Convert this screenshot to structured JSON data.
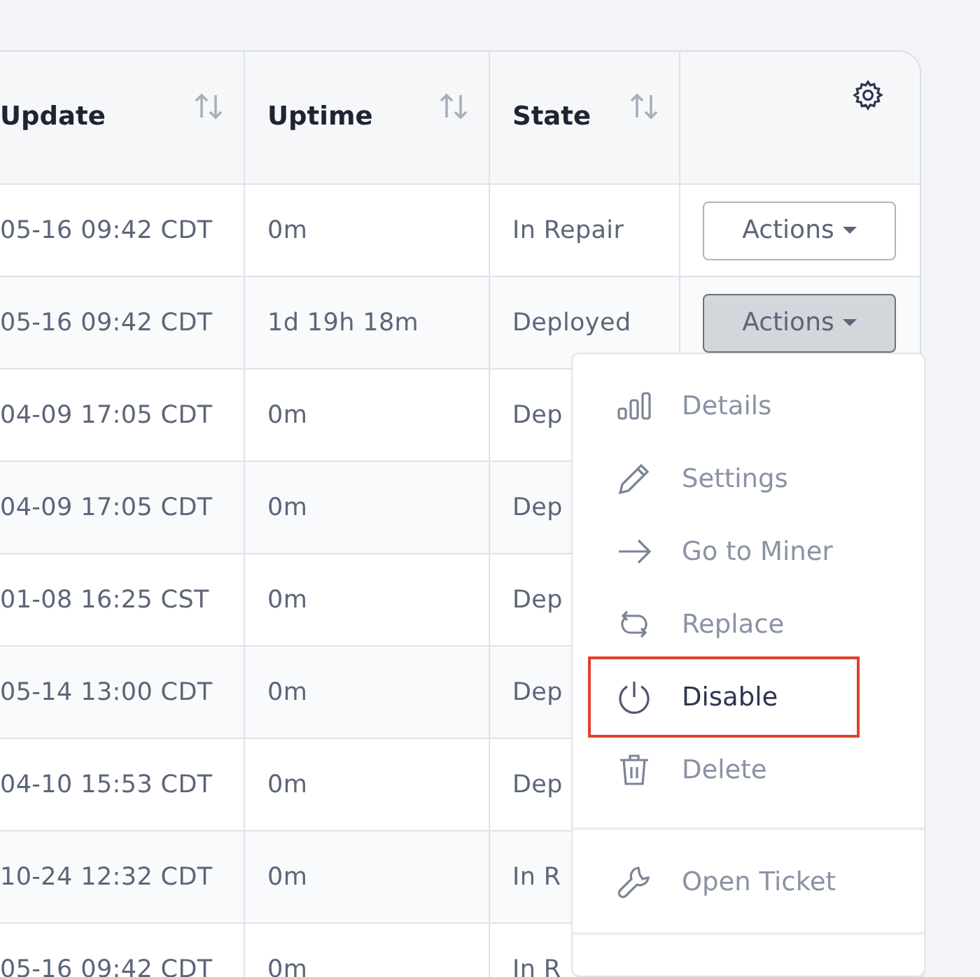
{
  "table": {
    "columns": [
      {
        "label": "Update"
      },
      {
        "label": "Uptime"
      },
      {
        "label": "State"
      }
    ],
    "rows": [
      {
        "update": "05-16 09:42 CDT",
        "uptime": "0m",
        "state": "In Repair",
        "action": {
          "label": "Actions",
          "pressed": false
        }
      },
      {
        "update": "05-16 09:42 CDT",
        "uptime": "1d 19h 18m",
        "state": "Deployed",
        "action": {
          "label": "Actions",
          "pressed": true
        }
      },
      {
        "update": "04-09 17:05 CDT",
        "uptime": "0m",
        "state": "Dep"
      },
      {
        "update": "04-09 17:05 CDT",
        "uptime": "0m",
        "state": "Dep"
      },
      {
        "update": "01-08 16:25 CST",
        "uptime": "0m",
        "state": "Dep"
      },
      {
        "update": "05-14 13:00 CDT",
        "uptime": "0m",
        "state": "Dep"
      },
      {
        "update": "04-10 15:53 CDT",
        "uptime": "0m",
        "state": "Dep"
      },
      {
        "update": "10-24 12:32 CDT",
        "uptime": "0m",
        "state": "In R"
      },
      {
        "update": "05-16 09:42 CDT",
        "uptime": "0m",
        "state": "In R"
      }
    ]
  },
  "actions_menu": {
    "sections": [
      {
        "items": [
          {
            "label": "Details",
            "highlighted": false
          },
          {
            "label": "Settings",
            "highlighted": false
          },
          {
            "label": "Go to Miner",
            "highlighted": false
          },
          {
            "label": "Replace",
            "highlighted": false
          },
          {
            "label": "Disable",
            "highlighted": true
          },
          {
            "label": "Delete",
            "highlighted": false
          }
        ]
      },
      {
        "items": [
          {
            "label": "Open Ticket",
            "highlighted": false
          }
        ]
      }
    ]
  }
}
